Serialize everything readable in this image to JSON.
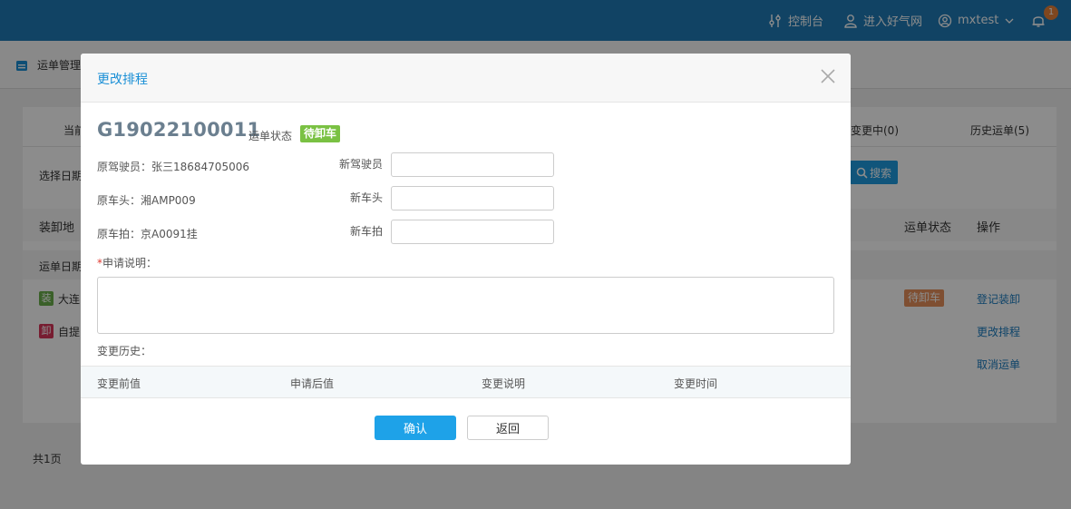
{
  "topbar": {
    "console_label": "控制台",
    "portal_label": "进入好气网",
    "user_label": "mxtest",
    "notification_count": "1"
  },
  "page": {
    "breadcrumb": "运单管理",
    "tab_current": "当前",
    "tab_changing": "变更中(0)",
    "tab_history": "历史运单(5)",
    "date_filter_label": "选择日期",
    "search_label": "搜索",
    "col_location": "装卸地",
    "col_status": "运单状态",
    "col_action": "操作",
    "date_row_label": "运单日期",
    "row1_tag": "装",
    "row1_place": "大连",
    "row2_tag": "卸",
    "row2_place": "自提",
    "row_status": "待卸车",
    "action_register": "登记装卸",
    "action_reschedule": "更改排程",
    "action_cancel": "取消运单",
    "pagination": "共1页"
  },
  "modal": {
    "title": "更改排程",
    "order_no": "G19022100011",
    "status_label": "运单状态",
    "status_value": "待卸车",
    "orig_driver": "原驾驶员：张三18684705006",
    "orig_head": "原车头：湘AMP009",
    "orig_trailer": "原车拍：京A0091挂",
    "new_driver_label": "新驾驶员",
    "new_head_label": "新车头",
    "new_trailer_label": "新车拍",
    "new_driver_value": "",
    "new_head_value": "",
    "new_trailer_value": "",
    "required_mark": "*",
    "reason_label": "申请说明：",
    "reason_value": "",
    "history_label": "变更历史：",
    "history_columns": [
      "变更前值",
      "申请后值",
      "变更说明",
      "变更时间"
    ],
    "confirm_label": "确认",
    "back_label": "返回"
  },
  "colors": {
    "topbar": "#1f7bb6",
    "accent": "#1ea2e8",
    "status_green": "#7ac143",
    "status_orange": "#e8915b"
  }
}
